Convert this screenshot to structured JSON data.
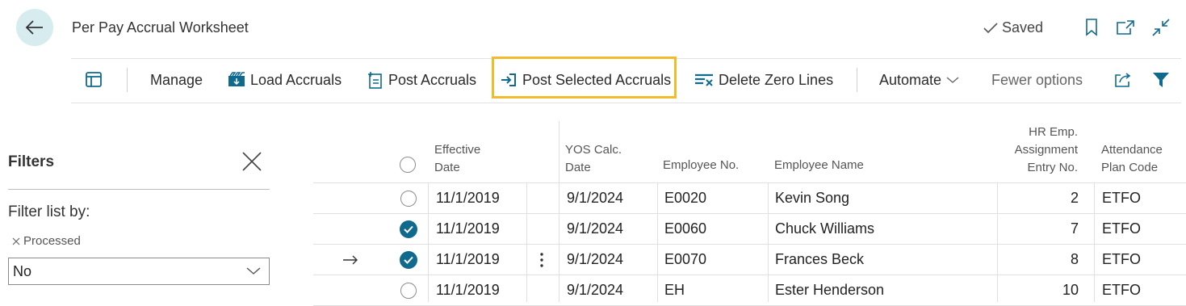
{
  "header": {
    "title": "Per Pay Accrual Worksheet",
    "saved_label": "Saved"
  },
  "actions": {
    "manage": "Manage",
    "load_accruals": "Load Accruals",
    "post_accruals": "Post Accruals",
    "post_selected_accruals": "Post Selected Accruals",
    "delete_zero_lines": "Delete Zero Lines",
    "automate": "Automate",
    "fewer_options": "Fewer options"
  },
  "filters": {
    "title": "Filters",
    "filter_list_by": "Filter list by:",
    "chip_label": "Processed",
    "value": "No"
  },
  "columns": {
    "effective_date": [
      "Effective",
      "Date"
    ],
    "yos_calc_date": [
      "YOS Calc.",
      "Date"
    ],
    "employee_no": "Employee No.",
    "employee_name": "Employee Name",
    "hr_emp": [
      "HR Emp.",
      "Assignment",
      "Entry No."
    ],
    "attendance": [
      "Attendance",
      "Plan Code"
    ]
  },
  "rows": [
    {
      "selected": false,
      "current": false,
      "effective_date": "11/1/2019",
      "yos_date": "9/1/2024",
      "employee_no": "E0020",
      "employee_name": "Kevin Song",
      "entry_no": "2",
      "plan_code": "ETFO"
    },
    {
      "selected": true,
      "current": false,
      "effective_date": "11/1/2019",
      "yos_date": "9/1/2024",
      "employee_no": "E0060",
      "employee_name": "Chuck Williams",
      "entry_no": "7",
      "plan_code": "ETFO"
    },
    {
      "selected": true,
      "current": true,
      "effective_date": "11/1/2019",
      "yos_date": "9/1/2024",
      "employee_no": "E0070",
      "employee_name": "Frances Beck",
      "entry_no": "8",
      "plan_code": "ETFO"
    },
    {
      "selected": false,
      "current": false,
      "effective_date": "11/1/2019",
      "yos_date": "9/1/2024",
      "employee_no": "EH",
      "employee_name": "Ester Henderson",
      "entry_no": "10",
      "plan_code": "ETFO"
    }
  ],
  "colors": {
    "accent": "#0f6a8e",
    "highlight": "#f2bb2b",
    "back_button_bg": "#d7ecee"
  }
}
